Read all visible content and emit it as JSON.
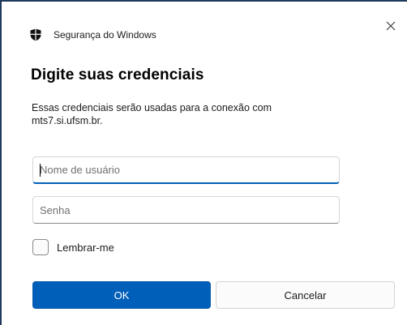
{
  "window": {
    "app_title": "Segurança do Windows",
    "close_glyph": "×"
  },
  "dialog": {
    "heading": "Digite suas credenciais",
    "description_line1": "Essas credenciais serão usadas para a conexão com",
    "description_line2": "mts7.si.ufsm.br."
  },
  "form": {
    "username": {
      "placeholder": "Nome de usuário",
      "value": ""
    },
    "password": {
      "placeholder": "Senha",
      "value": ""
    },
    "remember": {
      "label": "Lembrar-me",
      "checked": false
    }
  },
  "buttons": {
    "ok_label": "OK",
    "cancel_label": "Cancelar"
  },
  "colors": {
    "accent": "#005fb8",
    "frame": "#1f3a5a"
  },
  "icons": {
    "app": "shield-icon",
    "close": "close-icon"
  }
}
